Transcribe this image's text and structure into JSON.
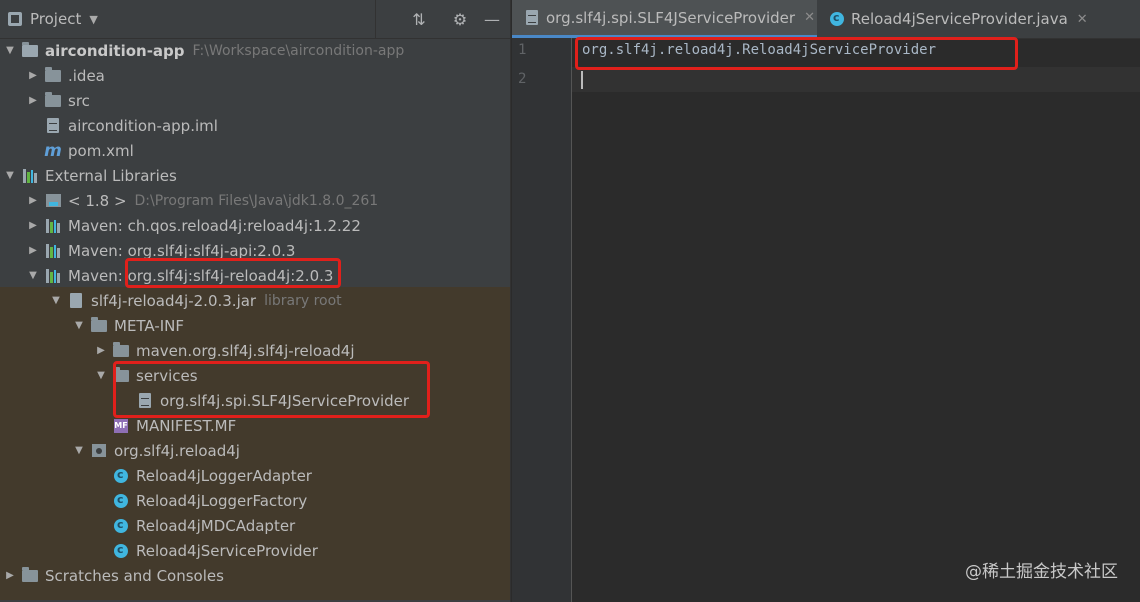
{
  "project_panel": {
    "title": "Project"
  },
  "tree": [
    {
      "label": "aircondition-app",
      "path": "F:\\Workspace\\aircondition-app"
    },
    {
      "label": ".idea"
    },
    {
      "label": "src"
    },
    {
      "label": "aircondition-app.iml"
    },
    {
      "label": "pom.xml"
    },
    {
      "label": "External Libraries"
    },
    {
      "label": "< 1.8 >",
      "path": "D:\\Program Files\\Java\\jdk1.8.0_261"
    },
    {
      "label": "Maven: ch.qos.reload4j:reload4j:1.2.22"
    },
    {
      "label": "Maven: org.slf4j:slf4j-api:2.0.3"
    },
    {
      "label_prefix": "Maven: ",
      "label": "org.slf4j:slf4j-reload4j:2.0.3"
    },
    {
      "label": "slf4j-reload4j-2.0.3.jar",
      "path": "library root"
    },
    {
      "label": "META-INF"
    },
    {
      "label": "maven.org.slf4j.slf4j-reload4j"
    },
    {
      "label": "services"
    },
    {
      "label": "org.slf4j.spi.SLF4JServiceProvider"
    },
    {
      "label": "MANIFEST.MF",
      "icon_text": "MF"
    },
    {
      "label": "org.slf4j.reload4j"
    },
    {
      "label": "Reload4jLoggerAdapter"
    },
    {
      "label": "Reload4jLoggerFactory"
    },
    {
      "label": "Reload4jMDCAdapter"
    },
    {
      "label": "Reload4jServiceProvider"
    },
    {
      "label": "Scratches and Consoles"
    }
  ],
  "editor": {
    "tabs": [
      {
        "label": "org.slf4j.spi.SLF4JServiceProvider",
        "active": true
      },
      {
        "label": "Reload4jServiceProvider.java",
        "active": false
      }
    ],
    "lines": [
      {
        "number": "1",
        "text": "org.slf4j.reload4j.Reload4jServiceProvider"
      },
      {
        "number": "2",
        "text": ""
      }
    ]
  },
  "watermark": "@稀土掘金技术社区",
  "colors": {
    "highlight": "#e0201b",
    "selection_band": "#433a2c",
    "accent": "#4a88c7"
  }
}
